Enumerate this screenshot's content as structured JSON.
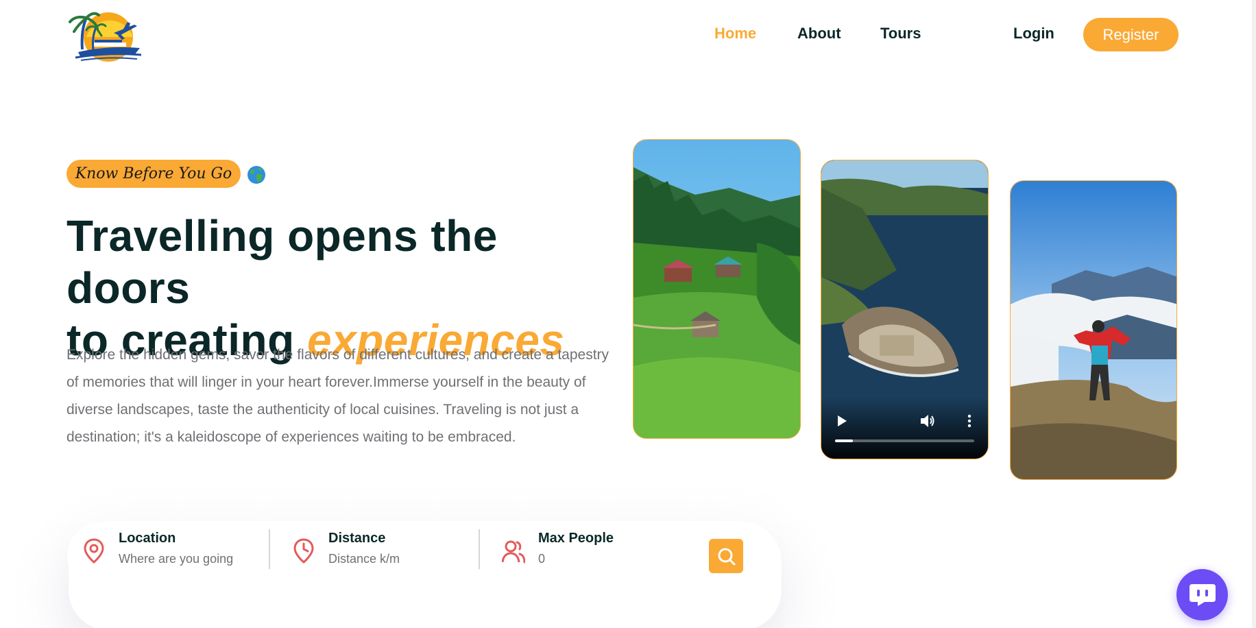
{
  "nav": {
    "logo": "travel-logo",
    "links": [
      {
        "label": "Home",
        "active": true
      },
      {
        "label": "About",
        "active": false
      },
      {
        "label": "Tours",
        "active": false
      }
    ],
    "login_label": "Login",
    "register_label": "Register"
  },
  "hero": {
    "subtitle": "Know Before You Go",
    "title_line1": "Travelling opens the doors",
    "title_line2_prefix": "to creating ",
    "title_highlight": "experiences",
    "description": "Explore the hidden gems, savor the flavors of different cultures, and create a tapestry of memories that will linger in your heart forever.Immerse yourself in the beauty of diverse landscapes, taste the authenticity of local cuisines. Traveling is not just a destination; it's a kaleidoscope of experiences waiting to be embraced."
  },
  "media": {
    "images": [
      {
        "name": "mountain-village-image"
      },
      {
        "name": "island-fortress-video"
      },
      {
        "name": "hiker-summit-image"
      }
    ],
    "video_progress": 0.13
  },
  "search": {
    "location": {
      "label": "Location",
      "placeholder": "Where are you going"
    },
    "distance": {
      "label": "Distance",
      "placeholder": "Distance k/m"
    },
    "people": {
      "label": "Max People",
      "placeholder": "0"
    }
  },
  "colors": {
    "accent": "#faa935",
    "heading": "#0b2727",
    "text": "#6e7074",
    "icon": "#e45a5a",
    "chat": "#6c4cf5"
  },
  "icons": [
    "map-pin-icon",
    "clock-icon",
    "users-icon",
    "search-icon",
    "chat-icon",
    "globe-icon",
    "play-icon",
    "volume-icon",
    "more-vertical-icon"
  ]
}
